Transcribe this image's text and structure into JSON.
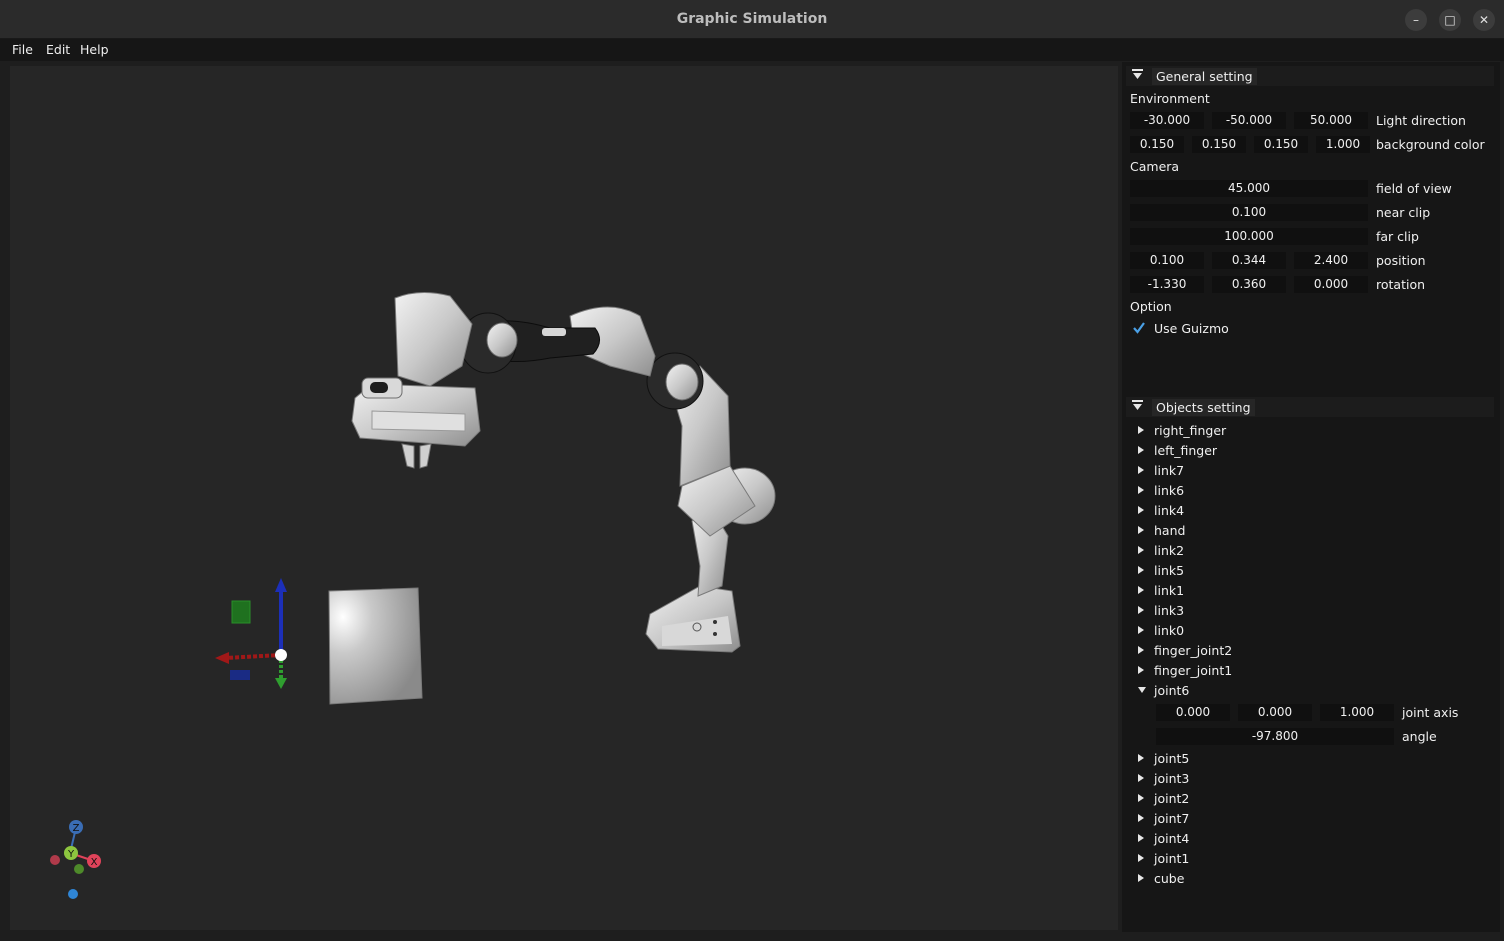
{
  "window": {
    "title": "Graphic Simulation",
    "buttons": [
      "–",
      "□",
      "✕"
    ]
  },
  "menu": [
    "File",
    "Edit",
    "Help"
  ],
  "general": {
    "header": "General setting",
    "environment_label": "Environment",
    "light_direction": {
      "values": [
        "-30.000",
        "-50.000",
        "50.000"
      ],
      "label": "Light direction"
    },
    "background_color": {
      "values": [
        "0.150",
        "0.150",
        "0.150",
        "1.000"
      ],
      "label": "background color"
    },
    "camera_label": "Camera",
    "field_of_view": {
      "value": "45.000",
      "label": "field of view"
    },
    "near_clip": {
      "value": "0.100",
      "label": "near clip"
    },
    "far_clip": {
      "value": "100.000",
      "label": "far clip"
    },
    "position": {
      "values": [
        "0.100",
        "0.344",
        "2.400"
      ],
      "label": "position"
    },
    "rotation": {
      "values": [
        "-1.330",
        "0.360",
        "0.000"
      ],
      "label": "rotation"
    },
    "option_label": "Option",
    "use_guizmo": {
      "label": "Use Guizmo",
      "checked": true
    }
  },
  "objects": {
    "header": "Objects setting",
    "items_before": [
      "right_finger",
      "left_finger",
      "link7",
      "link6",
      "link4",
      "hand",
      "link2",
      "link5",
      "link1",
      "link3",
      "link0",
      "finger_joint2",
      "finger_joint1"
    ],
    "expanded": {
      "name": "joint6",
      "joint_axis": {
        "values": [
          "0.000",
          "0.000",
          "1.000"
        ],
        "label": "joint axis"
      },
      "angle": {
        "value": "-97.800",
        "label": "angle"
      }
    },
    "items_after": [
      "joint5",
      "joint3",
      "joint2",
      "joint7",
      "joint4",
      "joint1",
      "cube"
    ]
  },
  "axis_gizmo": {
    "x": "X",
    "y": "Y",
    "z": "Z"
  },
  "colors": {
    "accent": "#4aa0e6",
    "x_axis": "#e0435a",
    "y_axis": "#8dc63f",
    "z_axis": "#3a6db5"
  }
}
